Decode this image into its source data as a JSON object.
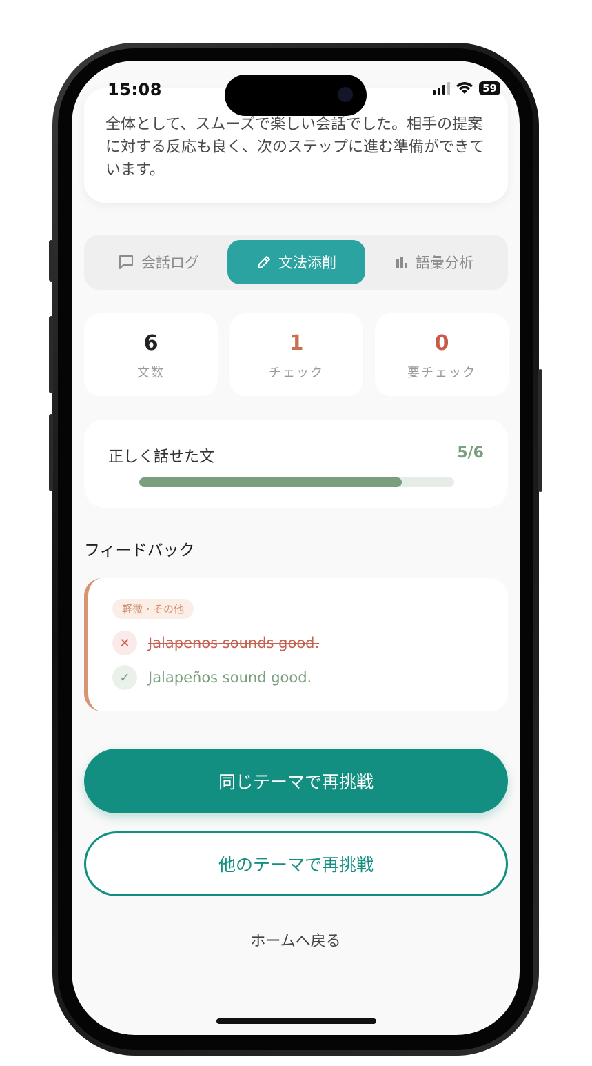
{
  "status_bar": {
    "time": "15:08",
    "battery": "59"
  },
  "summary": {
    "text": "全体として、スムーズで楽しい会話でした。相手の提案に対する反応も良く、次のステップに進む準備ができています。"
  },
  "tabs": [
    {
      "label": "会話ログ",
      "icon": "chat-bubble-icon",
      "active": false
    },
    {
      "label": "文法添削",
      "icon": "pencil-icon",
      "active": true
    },
    {
      "label": "語彙分析",
      "icon": "bar-chart-icon",
      "active": false
    }
  ],
  "stats": [
    {
      "value": "6",
      "label": "文数",
      "color": "#222222"
    },
    {
      "value": "1",
      "label": "チェック",
      "color": "#c8704e"
    },
    {
      "value": "0",
      "label": "要チェック",
      "color": "#c85a4a"
    }
  ],
  "progress": {
    "label": "正しく話せた文",
    "value": "5/6",
    "fraction": 0.8333,
    "color": "#7a9e7e"
  },
  "feedback": {
    "title": "フィードバック",
    "items": [
      {
        "tag": "軽微・その他",
        "wrong": "Jalapenos sounds good.",
        "correct": "Jalapeños sound good."
      }
    ]
  },
  "actions": {
    "retry_same": "同じテーマで再挑戦",
    "retry_other": "他のテーマで再挑戦",
    "home": "ホームへ戻る"
  },
  "colors": {
    "teal": "#128f80",
    "tab_active": "#2aa3a1",
    "accent_orange": "#d69470",
    "green": "#7a9e7e",
    "red": "#c85a4a"
  }
}
